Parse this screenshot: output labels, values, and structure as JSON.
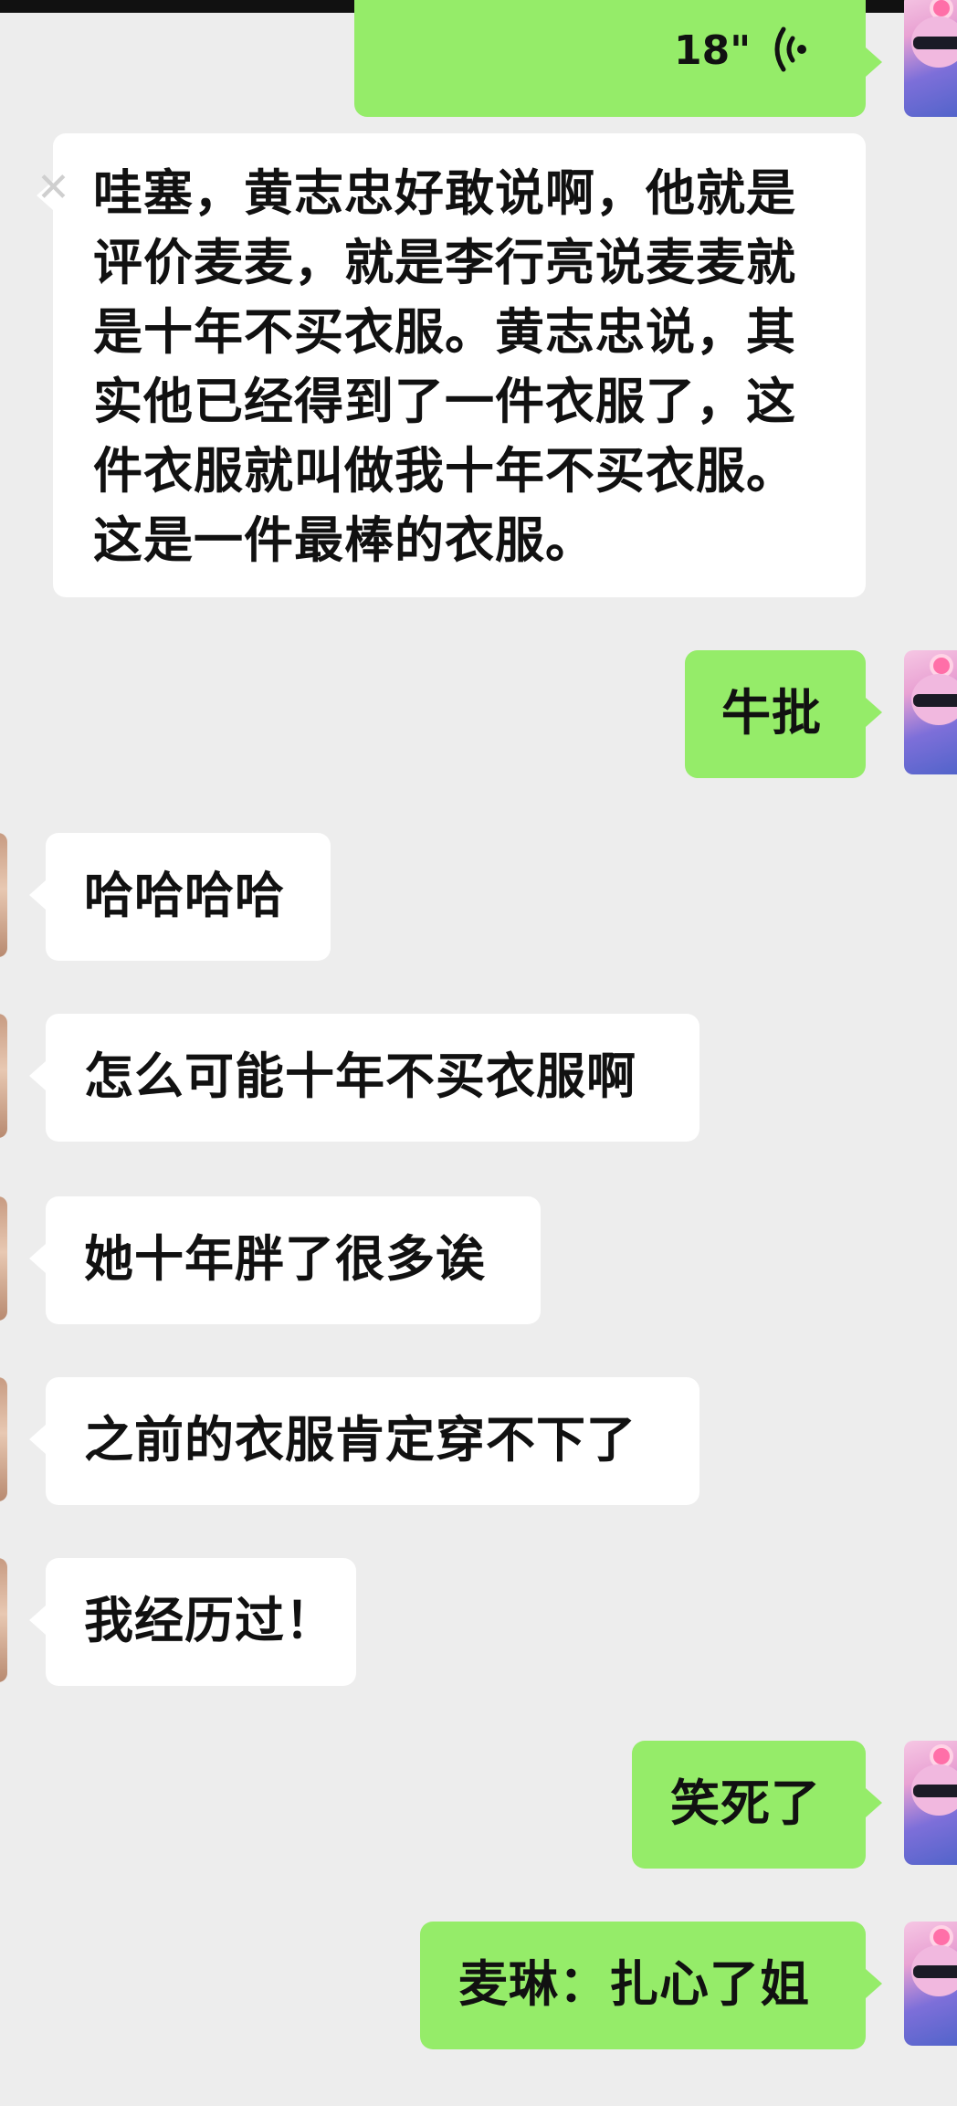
{
  "messages": [
    {
      "side": "right",
      "type": "voice",
      "duration": "18\""
    },
    {
      "side": "left",
      "type": "text",
      "lines": [
        "哇塞，黄志忠好敢说啊，他就是",
        "评价麦麦，就是李行亮说麦麦就",
        "是十年不买衣服。黄志忠说，其",
        "实他已经得到了一件衣服了，这",
        "件衣服就叫做我十年不买衣服。",
        "这是一件最棒的衣服。"
      ]
    },
    {
      "side": "right",
      "type": "text",
      "text": "牛批"
    },
    {
      "side": "left",
      "type": "text",
      "text": "哈哈哈哈"
    },
    {
      "side": "left",
      "type": "text",
      "text": "怎么可能十年不买衣服啊"
    },
    {
      "side": "left",
      "type": "text",
      "text": "她十年胖了很多诶"
    },
    {
      "side": "left",
      "type": "text",
      "text": "之前的衣服肯定穿不下了"
    },
    {
      "side": "left",
      "type": "text",
      "text": "我经历过！"
    },
    {
      "side": "right",
      "type": "text",
      "text": "笑死了"
    },
    {
      "side": "right",
      "type": "text",
      "text": "麦琳：扎心了姐"
    }
  ],
  "icons": {
    "voice": "voice-wave-icon",
    "avatar_self": "avatar-icon",
    "avatar_other": "avatar-icon",
    "close": "close-icon"
  },
  "colors": {
    "self_bubble": "#95ec69",
    "other_bubble": "#ffffff",
    "background": "#ededed"
  }
}
